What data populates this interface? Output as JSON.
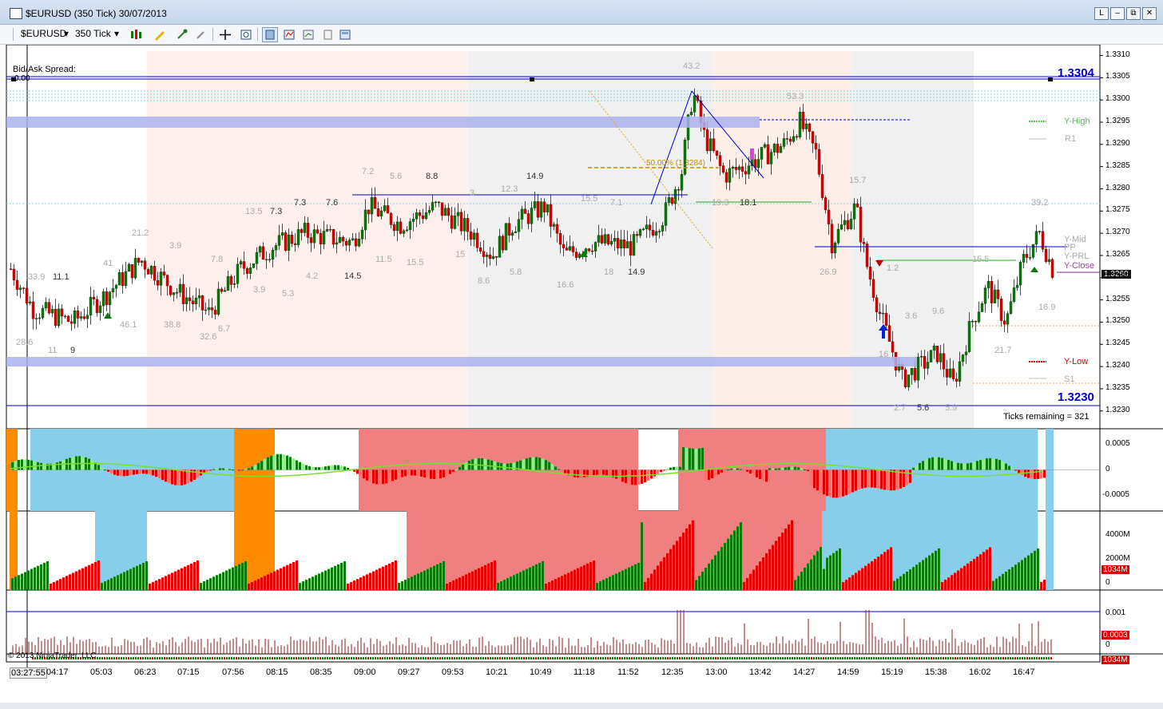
{
  "window": {
    "title": "$EURUSD (350 Tick)  30/07/2013",
    "buttons": [
      "L",
      "–",
      "⧉",
      "✕"
    ]
  },
  "toolbar": {
    "instrument": "$EURUSD",
    "interval": "350 Tick"
  },
  "chart": {
    "bid_ask_label": "Bid/Ask Spread:",
    "bid_ask_value": "0.00",
    "level_top": "1.3304",
    "level_bottom": "1.3230",
    "ticks_remaining": "Ticks remaining = 321",
    "copyright": "© 2013 NinjaTrader, LLC",
    "price_axis": [
      "1.3310",
      "1.3305",
      "1.3300",
      "1.3295",
      "1.3290",
      "1.3285",
      "1.3280",
      "1.3275",
      "1.3270",
      "1.3265",
      "1.3260",
      "1.3255",
      "1.3250",
      "1.3245",
      "1.3240",
      "1.3235",
      "1.3230"
    ],
    "current_price": "1.3260",
    "pivot_labels": [
      "Y-High",
      "R1",
      "Y-Mid",
      "PP",
      "Y-PRL",
      "Y-Close",
      "Y-Low",
      "S1"
    ],
    "fib_label": "50.00% (1.3284)",
    "panel2_axis": [
      "0.0005",
      "0",
      "-0.0005"
    ],
    "panel3_axis": [
      "4000M",
      "2000M",
      "0"
    ],
    "panel3_value": "1034M",
    "panel4_axis": [
      "0.001",
      "0"
    ],
    "panel4_value": "0.0003",
    "panel5_value": "1034M",
    "time_axis": [
      "03:27:55",
      "04:17",
      "05:03",
      "06:23",
      "07:15",
      "07:56",
      "08:15",
      "08:35",
      "09:00",
      "09:27",
      "09:53",
      "10:21",
      "10:49",
      "11:18",
      "11:52",
      "12:35",
      "13:00",
      "13:42",
      "14:27",
      "14:59",
      "15:19",
      "15:38",
      "16:02",
      "16:47"
    ],
    "volume_numbers": [
      "33.9",
      "11.1",
      "28.6",
      "11",
      "9",
      "41",
      "46.1",
      "21.2",
      "3.9",
      "38.8",
      "7.8",
      "32.6",
      "6.7",
      "13.5",
      "7.3",
      "3.9",
      "7.3",
      "5.3",
      "4.2",
      "7.6",
      "14.5",
      "7.2",
      "5.6",
      "8.8",
      "11.5",
      "15.5",
      "3",
      "12.3",
      "15",
      "14.9",
      "8.6",
      "5.8",
      "15.5",
      "7.1",
      "16.6",
      "18",
      "14.9",
      "43.2",
      "19.3",
      "18.1",
      "53.3",
      "15.7",
      "26.9",
      "39.2",
      "1.2",
      "3.6",
      "9.6",
      "15.5",
      "16",
      "21.7",
      "16.9",
      "2.7",
      "5.6",
      "5.9"
    ]
  },
  "colors": {
    "candle_up": "#0a7a0a",
    "candle_down": "#e00000",
    "blue_band": "#87ceeb",
    "red_band": "#f08080",
    "orange_band": "#ff8c00",
    "level_line": "#0000cc"
  }
}
